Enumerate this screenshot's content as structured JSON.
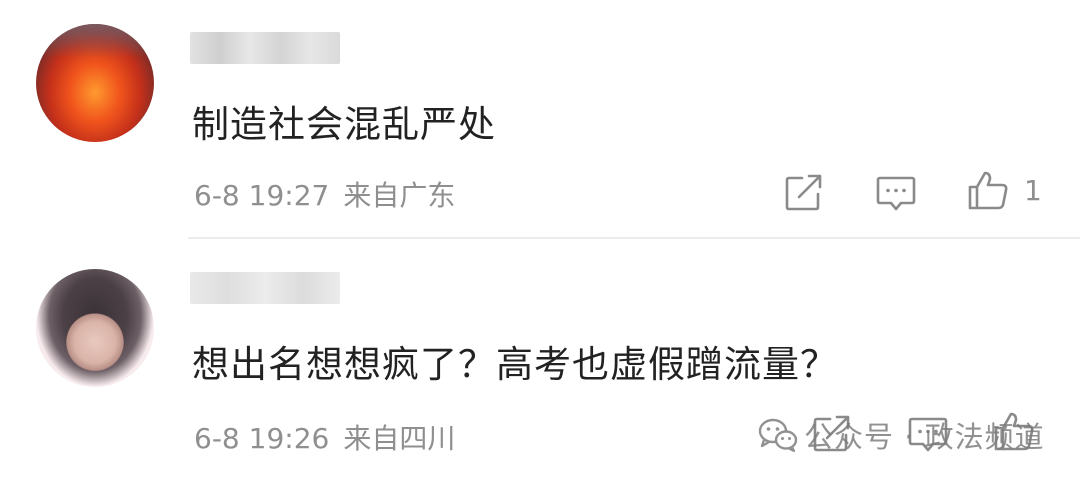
{
  "comments": [
    {
      "text": "制造社会混乱严处",
      "date": "6-8 19:27",
      "location": "来自广东",
      "likes": "1"
    },
    {
      "text": "想出名想想疯了？高考也虚假蹭流量？",
      "date": "6-8 19:26",
      "location": "来自四川"
    }
  ],
  "icons": {
    "share": "share-icon",
    "reply": "comment-icon",
    "like": "thumbs-up-icon"
  },
  "colors": {
    "text": "#222222",
    "meta": "#8f8f8f",
    "divider": "#ececec",
    "background": "#ffffff"
  },
  "watermark": {
    "text": "公众号 · 政法频道",
    "icon": "wechat-icon"
  }
}
